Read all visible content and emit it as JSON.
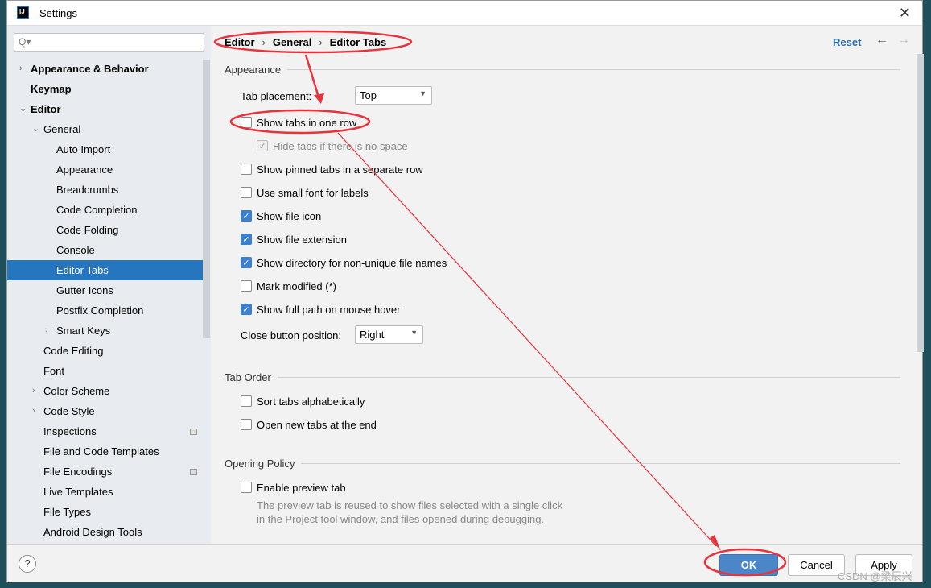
{
  "window": {
    "title": "Settings",
    "logo": "IJ"
  },
  "search": {
    "placeholder": "Q▾"
  },
  "tree": [
    {
      "label": "Appearance & Behavior",
      "level": 0,
      "bold": true,
      "arrow": "›"
    },
    {
      "label": "Keymap",
      "level": 0,
      "bold": true
    },
    {
      "label": "Editor",
      "level": 0,
      "bold": true,
      "arrow": "⌄"
    },
    {
      "label": "General",
      "level": 1,
      "arrow": "⌄"
    },
    {
      "label": "Auto Import",
      "level": 2
    },
    {
      "label": "Appearance",
      "level": 2
    },
    {
      "label": "Breadcrumbs",
      "level": 2
    },
    {
      "label": "Code Completion",
      "level": 2
    },
    {
      "label": "Code Folding",
      "level": 2
    },
    {
      "label": "Console",
      "level": 2
    },
    {
      "label": "Editor Tabs",
      "level": 2,
      "selected": true
    },
    {
      "label": "Gutter Icons",
      "level": 2
    },
    {
      "label": "Postfix Completion",
      "level": 2
    },
    {
      "label": "Smart Keys",
      "level": 2,
      "arrow": "›"
    },
    {
      "label": "Code Editing",
      "level": 1
    },
    {
      "label": "Font",
      "level": 1
    },
    {
      "label": "Color Scheme",
      "level": 1,
      "arrow": "›"
    },
    {
      "label": "Code Style",
      "level": 1,
      "arrow": "›"
    },
    {
      "label": "Inspections",
      "level": 1,
      "badge": true
    },
    {
      "label": "File and Code Templates",
      "level": 1
    },
    {
      "label": "File Encodings",
      "level": 1,
      "badge": true
    },
    {
      "label": "Live Templates",
      "level": 1
    },
    {
      "label": "File Types",
      "level": 1
    },
    {
      "label": "Android Design Tools",
      "level": 1
    }
  ],
  "breadcrumb": [
    "Editor",
    "General",
    "Editor Tabs"
  ],
  "reset": "Reset",
  "sections": {
    "appearance": "Appearance",
    "tab_order": "Tab Order",
    "opening": "Opening Policy"
  },
  "tab_placement": {
    "label": "Tab placement:",
    "value": "Top"
  },
  "close_button": {
    "label": "Close button position:",
    "value": "Right"
  },
  "options": [
    {
      "label": "Show tabs in one row",
      "checked": false
    },
    {
      "label": "Hide tabs if there is no space",
      "checked": true,
      "disabled": true
    },
    {
      "label": "Show pinned tabs in a separate row",
      "checked": false
    },
    {
      "label": "Use small font for labels",
      "checked": false
    },
    {
      "label": "Show file icon",
      "checked": true
    },
    {
      "label": "Show file extension",
      "checked": true
    },
    {
      "label": "Show directory for non-unique file names",
      "checked": true
    },
    {
      "label": "Mark modified (*)",
      "checked": false
    },
    {
      "label": "Show full path on mouse hover",
      "checked": true
    },
    {
      "label": "Sort tabs alphabetically",
      "checked": false
    },
    {
      "label": "Open new tabs at the end",
      "checked": false
    },
    {
      "label": "Enable preview tab",
      "checked": false
    }
  ],
  "preview_desc": [
    "The preview tab is reused to show files selected with a single click",
    "in the Project tool window, and files opened during debugging."
  ],
  "footer": {
    "help": "?",
    "ok": "OK",
    "cancel": "Cancel",
    "apply": "Apply"
  },
  "watermark": "CSDN @梁辰兴",
  "colors": {
    "selection": "#2675bf",
    "annotation": "#e8323c",
    "ok": "#4a86c8"
  }
}
